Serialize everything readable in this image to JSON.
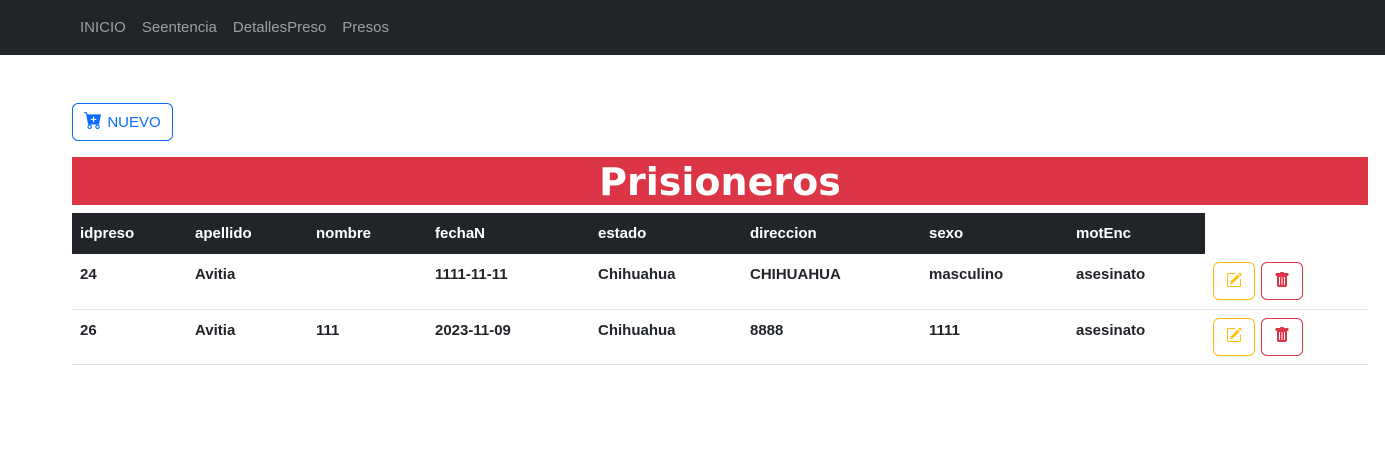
{
  "nav": {
    "items": [
      {
        "label": "INICIO"
      },
      {
        "label": "Seentencia"
      },
      {
        "label": "DetallesPreso"
      },
      {
        "label": "Presos"
      }
    ]
  },
  "toolbar": {
    "new_label": "NUEVO",
    "new_icon": "cart-plus-icon"
  },
  "page": {
    "title": "Prisioneros"
  },
  "table": {
    "columns": [
      "idpreso",
      "apellido",
      "nombre",
      "fechaN",
      "estado",
      "direccion",
      "sexo",
      "motEnc"
    ],
    "rows": [
      [
        "24",
        "Avitia",
        "",
        "1111-11-11",
        "Chihuahua",
        "CHIHUAHUA",
        "masculino",
        "asesinato"
      ],
      [
        "26",
        "Avitia",
        "111",
        "2023-11-09",
        "Chihuahua",
        "8888",
        "1111",
        "asesinato"
      ]
    ],
    "actions": {
      "edit_icon": "edit-icon",
      "delete_icon": "trash-icon"
    }
  },
  "colors": {
    "navbar": "#212529",
    "title_bg": "#dc3545",
    "primary": "#0d6efd",
    "warning": "#ffc107",
    "danger": "#dc3545"
  }
}
